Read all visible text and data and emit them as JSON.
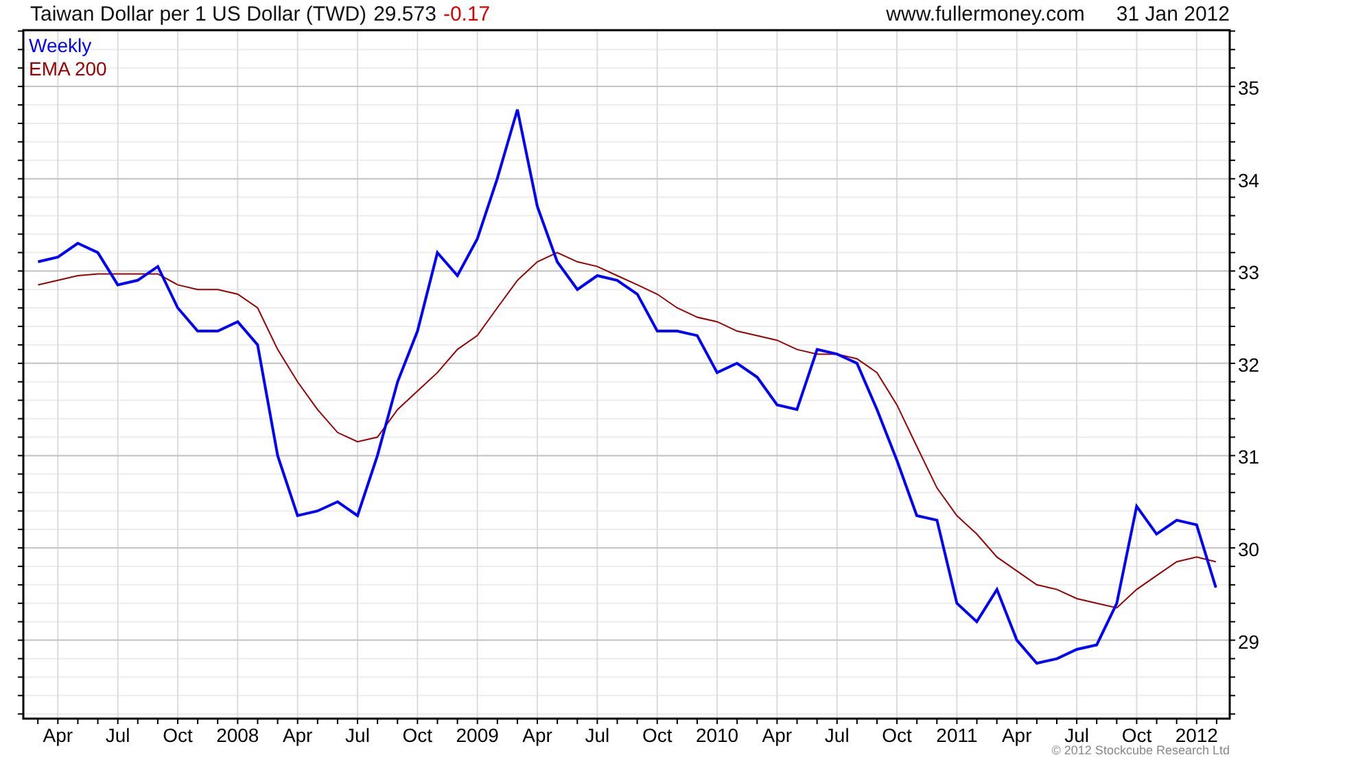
{
  "header": {
    "title": "Taiwan Dollar per 1 US Dollar (TWD)",
    "last": "29.573",
    "change": "-0.17",
    "site": "www.fullermoney.com",
    "date": "31 Jan 2012"
  },
  "chart": {
    "chart_data": {
      "type": "line",
      "x": [
        2007.167,
        2007.25,
        2007.333,
        2007.417,
        2007.5,
        2007.583,
        2007.667,
        2007.75,
        2007.833,
        2007.917,
        2008,
        2008.083,
        2008.167,
        2008.25,
        2008.333,
        2008.417,
        2008.5,
        2008.583,
        2008.667,
        2008.75,
        2008.833,
        2008.917,
        2009,
        2009.083,
        2009.167,
        2009.25,
        2009.333,
        2009.417,
        2009.5,
        2009.583,
        2009.667,
        2009.75,
        2009.833,
        2009.917,
        2010,
        2010.083,
        2010.167,
        2010.25,
        2010.333,
        2010.417,
        2010.5,
        2010.583,
        2010.667,
        2010.75,
        2010.833,
        2010.917,
        2011,
        2011.083,
        2011.167,
        2011.25,
        2011.333,
        2011.417,
        2011.5,
        2011.583,
        2011.667,
        2011.75,
        2011.833,
        2011.917,
        2012,
        2012.08
      ],
      "series": [
        {
          "name": "Weekly",
          "color": "#0000ff",
          "values": [
            33.1,
            33.15,
            33.3,
            33.2,
            32.85,
            32.9,
            33.05,
            32.6,
            32.35,
            32.35,
            32.45,
            32.2,
            31.0,
            30.35,
            30.4,
            30.5,
            30.35,
            31.0,
            31.8,
            32.35,
            33.2,
            32.95,
            33.35,
            34.0,
            34.75,
            33.7,
            33.1,
            32.8,
            32.95,
            32.9,
            32.75,
            32.35,
            32.35,
            32.3,
            31.9,
            32.0,
            31.85,
            31.55,
            31.5,
            32.15,
            32.1,
            32.0,
            31.5,
            30.95,
            30.35,
            30.3,
            29.4,
            29.2,
            29.55,
            29.0,
            28.75,
            28.8,
            28.9,
            28.95,
            29.4,
            30.45,
            30.15,
            30.3,
            30.25,
            29.57
          ]
        },
        {
          "name": "EMA 200",
          "color": "#990000",
          "values": [
            32.85,
            32.9,
            32.95,
            32.97,
            32.97,
            32.97,
            32.97,
            32.85,
            32.8,
            32.8,
            32.75,
            32.6,
            32.15,
            31.8,
            31.5,
            31.25,
            31.15,
            31.2,
            31.5,
            31.7,
            31.9,
            32.15,
            32.3,
            32.6,
            32.9,
            33.1,
            33.2,
            33.1,
            33.05,
            32.95,
            32.85,
            32.75,
            32.6,
            32.5,
            32.45,
            32.35,
            32.3,
            32.25,
            32.15,
            32.1,
            32.1,
            32.05,
            31.9,
            31.55,
            31.1,
            30.65,
            30.35,
            30.15,
            29.9,
            29.75,
            29.6,
            29.55,
            29.45,
            29.4,
            29.35,
            29.55,
            29.7,
            29.85,
            29.9,
            29.85
          ]
        }
      ],
      "xlim": [
        2007.106,
        2012.138
      ],
      "ylim": [
        28.15,
        35.61
      ],
      "xticks": [
        {
          "value": 2007.25,
          "label": "Apr"
        },
        {
          "value": 2007.5,
          "label": "Jul"
        },
        {
          "value": 2007.75,
          "label": "Oct"
        },
        {
          "value": 2008,
          "label": "2008"
        },
        {
          "value": 2008.25,
          "label": "Apr"
        },
        {
          "value": 2008.5,
          "label": "Jul"
        },
        {
          "value": 2008.75,
          "label": "Oct"
        },
        {
          "value": 2009,
          "label": "2009"
        },
        {
          "value": 2009.25,
          "label": "Apr"
        },
        {
          "value": 2009.5,
          "label": "Jul"
        },
        {
          "value": 2009.75,
          "label": "Oct"
        },
        {
          "value": 2010,
          "label": "2010"
        },
        {
          "value": 2010.25,
          "label": "Apr"
        },
        {
          "value": 2010.5,
          "label": "Jul"
        },
        {
          "value": 2010.75,
          "label": "Oct"
        },
        {
          "value": 2011,
          "label": "2011"
        },
        {
          "value": 2011.25,
          "label": "Apr"
        },
        {
          "value": 2011.5,
          "label": "Jul"
        },
        {
          "value": 2011.75,
          "label": "Oct"
        },
        {
          "value": 2012,
          "label": "2012"
        }
      ],
      "yticks": [
        29,
        30,
        31,
        32,
        33,
        34,
        35
      ],
      "grid": true
    }
  },
  "footer": {
    "copyright": "© 2012 Stockcube Research Ltd"
  }
}
